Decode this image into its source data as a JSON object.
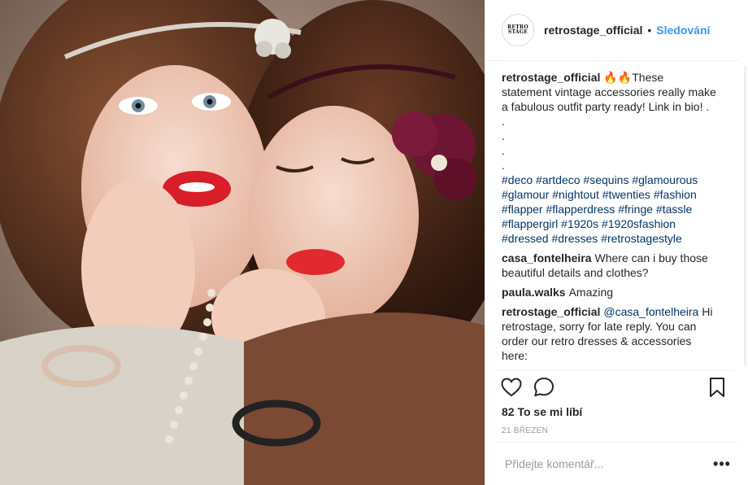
{
  "header": {
    "avatar_text": "RETRO STAGE",
    "username": "retrostage_official",
    "separator": "•",
    "follow_label": "Sledování"
  },
  "caption": {
    "username": "retrostage_official",
    "text": "🔥🔥These statement vintage accessories really make a fabulous outfit party ready! Link in bio! .",
    "dots": [
      ".",
      ".",
      ".",
      "."
    ],
    "hashtags": [
      "#deco",
      "#artdeco",
      "#sequins",
      "#glamourous",
      "#glamour",
      "#nightout",
      "#twenties",
      "#fashion",
      "#flapper",
      "#flapperdress",
      "#fringe",
      "#tassle",
      "#flappergirl",
      "#1920s",
      "#1920sfashion",
      "#dressed",
      "#dresses",
      "#retrostagestyle"
    ]
  },
  "comments": [
    {
      "username": "casa_fontelheira",
      "text": "Where can i buy those beautiful details and clothes?"
    },
    {
      "username": "paula.walks",
      "text": "Amazing"
    },
    {
      "username": "retrostage_official",
      "mention": "@casa_fontelheira",
      "text": "Hi retrostage, sorry for late reply. You can order our retro dresses & accessories here:"
    }
  ],
  "likes_label": "82 To se mi líbí",
  "date_label": "21 BŘEZEN",
  "add_comment": {
    "placeholder": "Přidejte komentář..."
  },
  "more_label": "•••",
  "icons": {
    "like": "heart-icon",
    "comment": "comment-bubble-icon",
    "save": "bookmark-icon"
  },
  "colors": {
    "accent": "#3897f0",
    "hashtag": "#003569",
    "muted": "#999999",
    "border": "#efefef"
  }
}
